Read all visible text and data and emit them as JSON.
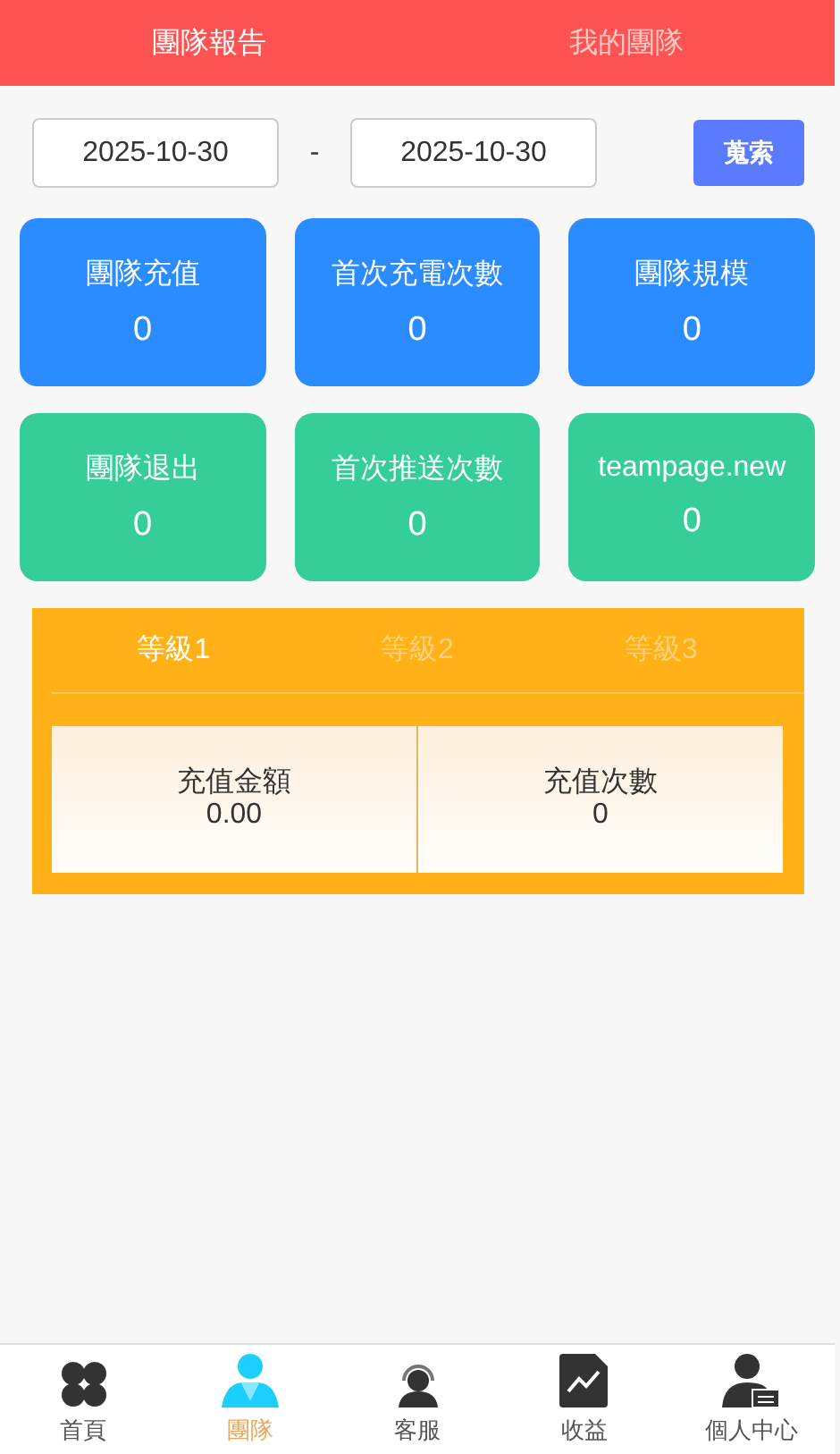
{
  "header_tabs": [
    {
      "label": "團隊報告",
      "selected": true
    },
    {
      "label": "我的團隊",
      "selected": false
    }
  ],
  "date_filter": {
    "start": "2025-10-30",
    "separator": "-",
    "end": "2025-10-30",
    "button": "蒐索"
  },
  "stat_cards": [
    {
      "label": "團隊充值",
      "value": "0",
      "color": "#2b8cff"
    },
    {
      "label": "首次充電次數",
      "value": "0",
      "color": "#2b8cff"
    },
    {
      "label": "團隊規模",
      "value": "0",
      "color": "#2b8cff"
    },
    {
      "label": "團隊退出",
      "value": "0",
      "color": "#36ce98"
    },
    {
      "label": "首次推送次數",
      "value": "0",
      "color": "#36ce98"
    },
    {
      "label": "teampage.new",
      "value": "0",
      "color": "#36ce98"
    }
  ],
  "levels": {
    "tabs": [
      {
        "label": "等級1",
        "selected": true
      },
      {
        "label": "等級2",
        "selected": false
      },
      {
        "label": "等級3",
        "selected": false
      }
    ],
    "stats": [
      {
        "label": "充值金額",
        "value": "0.00"
      },
      {
        "label": "充值次數",
        "value": "0"
      }
    ]
  },
  "bottom_nav": [
    {
      "label": "首頁",
      "selected": false
    },
    {
      "label": "團隊",
      "selected": true
    },
    {
      "label": "客服",
      "selected": false
    },
    {
      "label": "收益",
      "selected": false
    },
    {
      "label": "個人中心",
      "selected": false
    }
  ]
}
